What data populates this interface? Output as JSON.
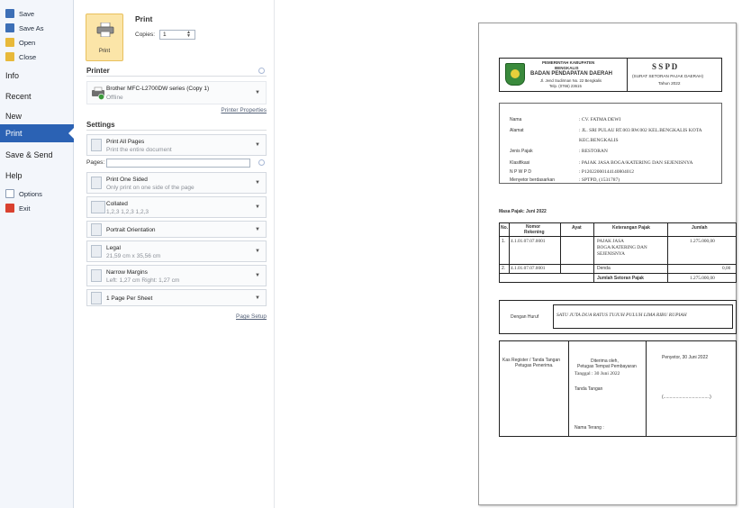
{
  "nav": {
    "save": "Save",
    "save_as": "Save As",
    "open": "Open",
    "close": "Close",
    "info": "Info",
    "recent": "Recent",
    "new": "New",
    "print": "Print",
    "save_send": "Save & Send",
    "help": "Help",
    "options": "Options",
    "exit": "Exit"
  },
  "print_panel": {
    "title": "Print",
    "button_label": "Print",
    "copies_label": "Copies:",
    "copies_value": "1"
  },
  "printer": {
    "section_title": "Printer",
    "name": "Brother MFC-L2700DW series (Copy 1)",
    "status": "Offline",
    "properties_link": "Printer Properties"
  },
  "settings": {
    "section_title": "Settings",
    "pages_label": "Pages:",
    "page_setup_link": "Page Setup",
    "items": [
      {
        "main": "Print All Pages",
        "sub": "Print the entire document"
      },
      {
        "main": "Print One Sided",
        "sub": "Only print on one side of the page"
      },
      {
        "main": "Collated",
        "sub": "1,2,3   1,2,3   1,2,3"
      },
      {
        "main": "Portrait Orientation",
        "sub": ""
      },
      {
        "main": "Legal",
        "sub": "21,59 cm x 35,56 cm"
      },
      {
        "main": "Narrow Margins",
        "sub": "Left:  1,27 cm   Right:  1,27 cm"
      },
      {
        "main": "1 Page Per Sheet",
        "sub": ""
      }
    ]
  },
  "doc": {
    "gov1": "PEMERINTAH KABUPATEN",
    "gov2": "BENGKALIS",
    "agency": "BADAN PENDAPATAN DAERAH",
    "address": "Jl. Jend Sudirman No. 22 Bengkalis",
    "phone": "Telp. (0766) 23615",
    "form_code": "S S P D",
    "form_name": "(SURAT SETORAN PAJAK DAERAH)",
    "year": "Tahun 2022",
    "fields": [
      {
        "label": "Nama",
        "value": ": CV. FATMA DEWI"
      },
      {
        "label": "Alamat",
        "value": ": JL. SRI PULAU RT.003 RW.002 KEL.BENGKALIS KOTA"
      },
      {
        "label": "",
        "value": "  KEC.BENGKALIS"
      },
      {
        "label": "Jenis Pajak",
        "value": ": RESTORAN"
      },
      {
        "label": "Klasifikasi",
        "value": ": PAJAK JASA BOGA/KATERING DAN SEJENISNYA"
      },
      {
        "label": "N P W P D",
        "value": ": P12022000144140804012"
      },
      {
        "label": "Menyetor berdasarkan",
        "value": ": SPTPD, (1531787)"
      }
    ],
    "masa_pajak": "Masa Pajak: Juni 2022",
    "table_headers": {
      "no": "No.",
      "rekening1": "Nomor",
      "rekening2": "Rekening",
      "ayat": "Ayat",
      "keterangan": "Keterangan Pajak",
      "jumlah": "Jumlah"
    },
    "rows": [
      {
        "no": "1.",
        "rekening": "4.1.01.07.07.0001",
        "ket": [
          "PAJAK JASA",
          "BOGA/KATERING DAN",
          "SEJENISNYA"
        ],
        "jumlah": "1.275.000,00"
      },
      {
        "no": "2.",
        "rekening": "4.1.01.07.07.0001",
        "ket": [
          "Denda"
        ],
        "jumlah": "0,00"
      }
    ],
    "total_label": "Jumlah Setoran Pajak",
    "total_value": "1.275.000,00",
    "terbilang_label": "Dengan Huruf",
    "terbilang_value": "SATU JUTA DUA RATUS TUJUH PULUH LIMA RIBU RUPIAH",
    "sig_left1": "Kas Register / Tanda Tangan",
    "sig_left2": "Petugas Penerima.",
    "sig_mid1": "Diterima oleh,",
    "sig_mid2": "Petugas Tempat Pembayaran",
    "sig_mid3": "Tanggal  : 30 Juni 2022",
    "sig_mid4": "Tanda Tangan",
    "sig_mid5": "Nama Terang :",
    "sig_right1": "Penyetor, 30 Juni 2022",
    "sig_right2": "(.....................................)"
  },
  "colors": {
    "nav_selected": "#2b62b4",
    "print_button": "#fbe5a8",
    "offline_badge": "#3c9a3c"
  }
}
